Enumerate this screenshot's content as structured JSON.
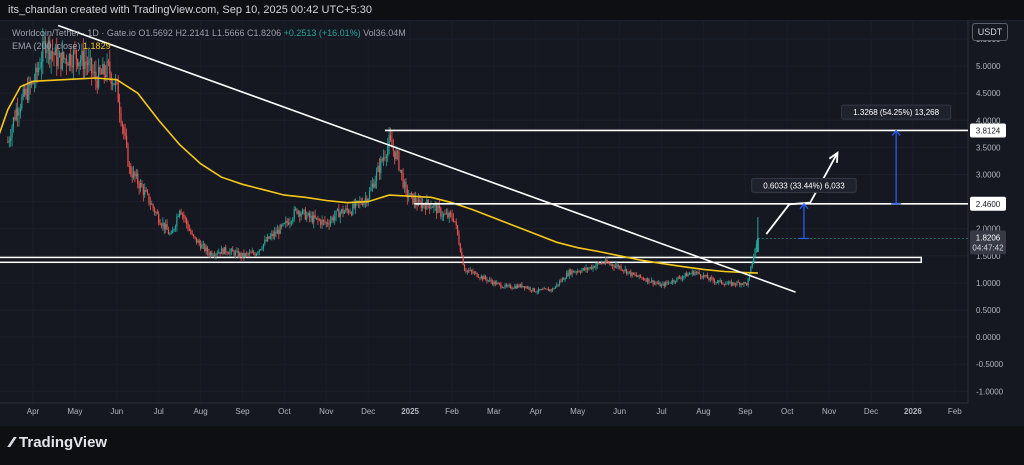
{
  "header": {
    "credit": "its_chandan created with TradingView.com, Sep 10, 2025 00:42 UTC+5:30"
  },
  "legend": {
    "line1_prefix": "Worldcoin/Tether · 1D · Gate.io ",
    "open": "O1.5692",
    "high": "H2.2141",
    "low": "L1.5666",
    "close": "C1.8206",
    "change": "+0.2513 (+16.01%)",
    "volume": "Vol36.04M",
    "ema_label": "EMA (200, close)",
    "ema_value": "1.1829"
  },
  "currency": "USDT",
  "footer": {
    "logo_text": "TradingView"
  },
  "colors": {
    "background": "#151821",
    "up": "#26a69a",
    "down": "#ef5350",
    "ema": "#f5c71a",
    "annotation": "#ffffff",
    "measure": "#2962ff"
  },
  "chart_data": {
    "type": "candlestick",
    "symbol": "Worldcoin/Tether",
    "ylim": [
      -1.0,
      5.75
    ],
    "y_ticks": [
      5.5,
      5.0,
      4.5,
      4.0,
      3.5,
      3.0,
      2.5,
      2.0,
      1.5,
      1.0,
      0.5,
      0.0,
      -0.5,
      -1.0
    ],
    "y_tick_labels": [
      "5.5000",
      "5.0000",
      "4.5000",
      "4.0000",
      "3.5000",
      "3.0000",
      "2.5000",
      "2.0000",
      "1.5000",
      "1.0000",
      "0.5000",
      "0.0000",
      "-0.5000",
      "-1.0000"
    ],
    "x_labels": [
      "Apr",
      "May",
      "Jun",
      "Jul",
      "Aug",
      "Sep",
      "Oct",
      "Nov",
      "Dec",
      "2025",
      "Feb",
      "Mar",
      "Apr",
      "May",
      "Jun",
      "Jul",
      "Aug",
      "Sep",
      "Oct",
      "Nov",
      "Dec",
      "2026",
      "Feb"
    ],
    "x_label_month_index": [
      0,
      1,
      2,
      3,
      4,
      5,
      6,
      7,
      8,
      9,
      10,
      11,
      12,
      13,
      14,
      15,
      16,
      17,
      18,
      19,
      20,
      21,
      22
    ],
    "x_labels_bold": [
      "2025",
      "2026"
    ],
    "last_candle_month_index": 17.3,
    "price_anchors": [
      [
        -0.6,
        3.6
      ],
      [
        -0.4,
        4.2
      ],
      [
        0.05,
        4.75
      ],
      [
        0.3,
        5.45
      ],
      [
        0.6,
        5.1
      ],
      [
        1.0,
        5.2
      ],
      [
        1.3,
        5.05
      ],
      [
        1.5,
        4.75
      ],
      [
        1.8,
        4.95
      ],
      [
        2.0,
        4.6
      ],
      [
        2.3,
        3.1
      ],
      [
        2.6,
        2.75
      ],
      [
        3.0,
        2.2
      ],
      [
        3.3,
        1.85
      ],
      [
        3.5,
        2.4
      ],
      [
        3.8,
        1.85
      ],
      [
        4.2,
        1.55
      ],
      [
        4.6,
        1.6
      ],
      [
        5.0,
        1.5
      ],
      [
        5.3,
        1.55
      ],
      [
        5.6,
        1.8
      ],
      [
        6.0,
        2.05
      ],
      [
        6.3,
        2.35
      ],
      [
        6.6,
        2.2
      ],
      [
        7.0,
        2.1
      ],
      [
        7.3,
        2.3
      ],
      [
        7.6,
        2.35
      ],
      [
        8.0,
        2.6
      ],
      [
        8.3,
        3.2
      ],
      [
        8.5,
        3.6
      ],
      [
        8.7,
        3.3
      ],
      [
        8.9,
        2.65
      ],
      [
        9.2,
        2.45
      ],
      [
        9.5,
        2.45
      ],
      [
        9.8,
        2.25
      ],
      [
        10.05,
        2.2
      ],
      [
        10.3,
        1.25
      ],
      [
        10.6,
        1.15
      ],
      [
        11.0,
        1.0
      ],
      [
        11.3,
        0.92
      ],
      [
        11.7,
        0.95
      ],
      [
        12.0,
        0.85
      ],
      [
        12.4,
        0.88
      ],
      [
        12.8,
        1.2
      ],
      [
        13.2,
        1.25
      ],
      [
        13.6,
        1.38
      ],
      [
        14.0,
        1.3
      ],
      [
        14.3,
        1.15
      ],
      [
        14.7,
        1.05
      ],
      [
        15.0,
        0.95
      ],
      [
        15.3,
        1.05
      ],
      [
        15.6,
        1.15
      ],
      [
        15.8,
        1.2
      ],
      [
        16.2,
        1.05
      ],
      [
        16.6,
        0.98
      ],
      [
        16.9,
        1.0
      ],
      [
        17.05,
        0.98
      ],
      [
        17.2,
        1.5
      ],
      [
        17.3,
        1.82
      ]
    ],
    "ema200": {
      "name": "EMA (200, close)",
      "anchors": [
        [
          -0.85,
          3.65
        ],
        [
          -0.6,
          4.2
        ],
        [
          -0.3,
          4.62
        ],
        [
          0.0,
          4.72
        ],
        [
          0.5,
          4.74
        ],
        [
          1.0,
          4.76
        ],
        [
          1.5,
          4.78
        ],
        [
          2.0,
          4.75
        ],
        [
          2.5,
          4.5
        ],
        [
          3.0,
          4.0
        ],
        [
          3.5,
          3.55
        ],
        [
          4.0,
          3.2
        ],
        [
          4.5,
          2.95
        ],
        [
          5.0,
          2.82
        ],
        [
          5.5,
          2.72
        ],
        [
          6.0,
          2.62
        ],
        [
          6.5,
          2.58
        ],
        [
          7.0,
          2.52
        ],
        [
          7.5,
          2.48
        ],
        [
          8.0,
          2.5
        ],
        [
          8.5,
          2.62
        ],
        [
          9.0,
          2.6
        ],
        [
          9.5,
          2.58
        ],
        [
          10.0,
          2.48
        ],
        [
          10.5,
          2.35
        ],
        [
          11.0,
          2.2
        ],
        [
          11.5,
          2.05
        ],
        [
          12.0,
          1.9
        ],
        [
          12.5,
          1.75
        ],
        [
          13.0,
          1.65
        ],
        [
          13.5,
          1.58
        ],
        [
          14.0,
          1.5
        ],
        [
          14.5,
          1.42
        ],
        [
          15.0,
          1.36
        ],
        [
          15.5,
          1.3
        ],
        [
          16.0,
          1.25
        ],
        [
          16.5,
          1.21
        ],
        [
          17.0,
          1.19
        ],
        [
          17.3,
          1.18
        ]
      ]
    },
    "volume_label": "Vol36.04M",
    "last_price": {
      "value": 1.8206,
      "label": "1.8206",
      "countdown": "04:47:42"
    },
    "horizontal_levels": [
      {
        "value": 3.8124,
        "label": "3.8124",
        "start_month": 8.4
      },
      {
        "value": 2.46,
        "label": "2.4600",
        "start_month": 9.1
      }
    ],
    "support_zone": {
      "low": 1.38,
      "high": 1.47,
      "start_month": -0.85,
      "end_month": 21.2
    },
    "trendline": {
      "start": [
        0.6,
        5.75
      ],
      "end": [
        18.2,
        0.83
      ]
    },
    "measures": [
      {
        "label": "0.6033 (33.44%) 6,033",
        "x": 18.4,
        "from": 1.82,
        "to": 2.46,
        "label_x": 18.4,
        "label_y": 2.8
      },
      {
        "label": "1.3268 (54.25%) 13,268",
        "x": 20.6,
        "from": 2.46,
        "to": 3.8124,
        "label_x": 20.6,
        "label_y": 4.15
      }
    ],
    "projection_path": [
      [
        17.5,
        1.9
      ],
      [
        18.05,
        2.45
      ],
      [
        18.55,
        2.48
      ],
      [
        19.2,
        3.4
      ]
    ]
  }
}
